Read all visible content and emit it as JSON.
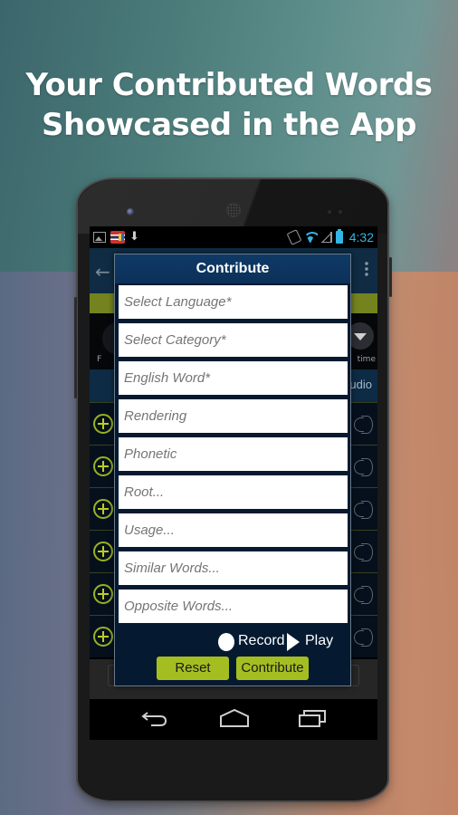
{
  "headline": {
    "line1": "Your Contributed Words",
    "line2": "Showcased in the App"
  },
  "status_bar": {
    "left_icons": [
      "gallery-icon",
      "flag-icon",
      "download-icon"
    ],
    "right_icons": [
      "rotate-icon",
      "wifi-icon",
      "signal-icon",
      "battery-icon"
    ],
    "time": "4:32",
    "accent_color": "#33b5e5"
  },
  "background_app": {
    "header_right_label": "udio",
    "filter_right_label": "time",
    "filter_left_label": "F",
    "rows": 6,
    "row_left_icon": "add-circle-icon",
    "row_right_icon": "speaker-icon"
  },
  "dialog": {
    "title": "Contribute",
    "fields": [
      {
        "name": "select-language",
        "placeholder": "Select Language*"
      },
      {
        "name": "select-category",
        "placeholder": "Select Category*"
      },
      {
        "name": "english-word",
        "placeholder": "English Word*"
      },
      {
        "name": "rendering",
        "placeholder": "Rendering"
      },
      {
        "name": "phonetic",
        "placeholder": "Phonetic"
      },
      {
        "name": "root",
        "placeholder": "Root..."
      },
      {
        "name": "usage",
        "placeholder": "Usage..."
      },
      {
        "name": "similar-words",
        "placeholder": "Similar Words..."
      },
      {
        "name": "opposite-words",
        "placeholder": "Opposite Words..."
      }
    ],
    "record_label": "Record",
    "play_label": "Play",
    "reset_label": "Reset",
    "contribute_label": "Contribute",
    "button_color": "#a4be22"
  },
  "nav_bar": {
    "icons": [
      "back-icon",
      "home-icon",
      "recent-apps-icon"
    ]
  }
}
